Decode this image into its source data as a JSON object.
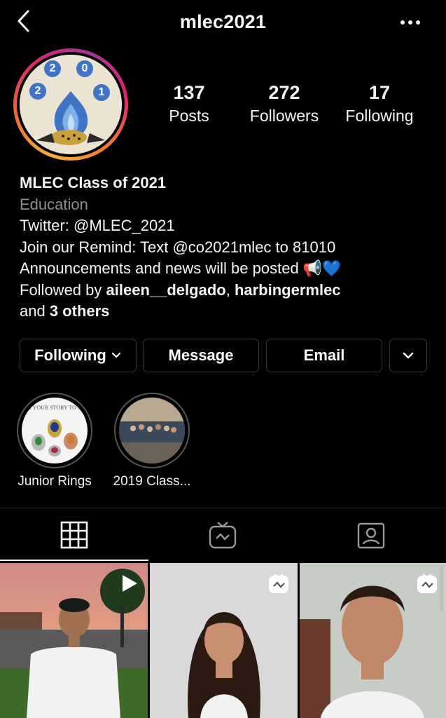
{
  "header": {
    "username": "mlec2021"
  },
  "avatar": {
    "year_digits": [
      "2",
      "0",
      "2",
      "1"
    ]
  },
  "stats": [
    {
      "value": "137",
      "label": "Posts"
    },
    {
      "value": "272",
      "label": "Followers"
    },
    {
      "value": "17",
      "label": "Following"
    }
  ],
  "bio": {
    "name": "MLEC Class of 2021",
    "category": "Education",
    "lines": [
      "Twitter: @MLEC_2021",
      "Join our Remind: Text @co2021mlec to 81010",
      "Announcements and news will be posted 📢💙"
    ],
    "followed_by_prefix": "Followed by ",
    "followed_by_users": [
      "aileen__delgado",
      "harbingermlec"
    ],
    "followed_by_sep": ", ",
    "followed_by_and": "and ",
    "followed_by_others": "3 others"
  },
  "actions": {
    "following": "Following",
    "message": "Message",
    "email": "Email"
  },
  "highlights": [
    {
      "label": "Junior Rings",
      "cover_text": "S YOUR STORY TO T"
    },
    {
      "label": "2019 Class..."
    }
  ],
  "tabs": [
    {
      "icon": "grid-icon",
      "active": true
    },
    {
      "icon": "igtv-icon",
      "active": false
    },
    {
      "icon": "tagged-icon",
      "active": false
    }
  ],
  "posts": [
    {
      "type": "video",
      "badge": "play-icon"
    },
    {
      "type": "igtv",
      "badge": "igtv-icon"
    },
    {
      "type": "igtv",
      "badge": "igtv-icon"
    }
  ],
  "colors": {
    "background": "#000000",
    "text": "#f5f5f5",
    "secondary_text": "#8e8e8e",
    "button_border": "#3a3a3a",
    "story_gradient": [
      "#f8b030",
      "#f06930",
      "#d9266c",
      "#a7329e"
    ]
  }
}
